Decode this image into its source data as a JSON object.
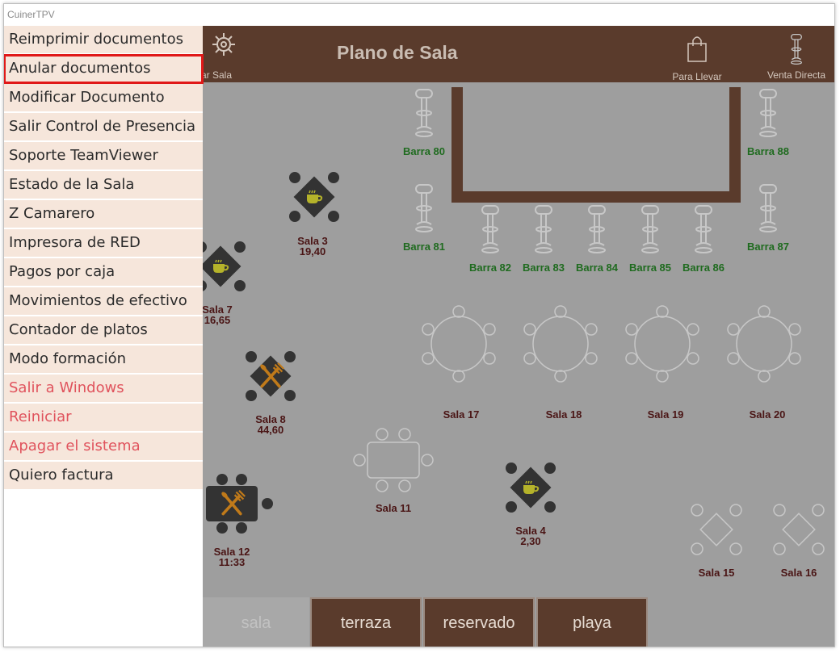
{
  "window": {
    "title": "CuinerTPV"
  },
  "header": {
    "title": "Plano de Sala",
    "config_label": "ar Sala",
    "takeaway_label": "Para Llevar",
    "direct_sale_label": "Venta Directa"
  },
  "menu": {
    "items": [
      {
        "label": "Reimprimir documentos",
        "style": "normal"
      },
      {
        "label": "Anular documentos",
        "style": "selected"
      },
      {
        "label": "Modificar Documento",
        "style": "normal"
      },
      {
        "label": "Salir Control de Presencia",
        "style": "normal"
      },
      {
        "label": "Soporte TeamViewer",
        "style": "normal"
      },
      {
        "label": "Estado de la Sala",
        "style": "normal"
      },
      {
        "label": "Z Camarero",
        "style": "normal"
      },
      {
        "label": "Impresora de RED",
        "style": "normal"
      },
      {
        "label": "Pagos por caja",
        "style": "normal"
      },
      {
        "label": "Movimientos de efectivo",
        "style": "normal"
      },
      {
        "label": "Contador de platos",
        "style": "normal"
      },
      {
        "label": "Modo formación",
        "style": "normal"
      },
      {
        "label": "Salir a Windows",
        "style": "red"
      },
      {
        "label": "Reiniciar",
        "style": "red"
      },
      {
        "label": "Apagar el sistema",
        "style": "red"
      },
      {
        "label": "Quiero factura",
        "style": "normal"
      }
    ]
  },
  "bar_stools": [
    {
      "name": "Barra 80"
    },
    {
      "name": "Barra 81"
    },
    {
      "name": "Barra 82"
    },
    {
      "name": "Barra 83"
    },
    {
      "name": "Barra 84"
    },
    {
      "name": "Barra 85"
    },
    {
      "name": "Barra 86"
    },
    {
      "name": "Barra 87"
    },
    {
      "name": "Barra 88"
    }
  ],
  "tables": {
    "sala3": {
      "name": "Sala 3",
      "value": "19,40",
      "status": "coffee"
    },
    "sala7": {
      "name": "Sala 7",
      "value": "16,65",
      "status": "coffee"
    },
    "sala8": {
      "name": "Sala 8",
      "value": "44,60",
      "status": "dining"
    },
    "sala12": {
      "name": "Sala 12",
      "value": "11:33",
      "status": "dining"
    },
    "sala4": {
      "name": "Sala 4",
      "value": "2,30",
      "status": "coffee"
    },
    "sala11": {
      "name": "Sala 11",
      "status": "free"
    },
    "sala15": {
      "name": "Sala 15",
      "status": "free"
    },
    "sala16": {
      "name": "Sala 16",
      "status": "free"
    },
    "sala17": {
      "name": "Sala 17",
      "status": "free"
    },
    "sala18": {
      "name": "Sala 18",
      "status": "free"
    },
    "sala19": {
      "name": "Sala 19",
      "status": "free"
    },
    "sala20": {
      "name": "Sala 20",
      "status": "free"
    }
  },
  "tabs": [
    {
      "label": "sala",
      "active": true
    },
    {
      "label": "terraza",
      "active": false
    },
    {
      "label": "reservado",
      "active": false
    },
    {
      "label": "playa",
      "active": false
    }
  ],
  "colors": {
    "header_bg": "#5a3b2c",
    "floor_bg": "#9e9e9e",
    "menu_bg": "#f6e6db",
    "stool_label": "#1f6b1f",
    "table_label": "#4a1515",
    "danger_text": "#e0535d",
    "selection_outline": "#e01818",
    "occupied_table": "#333333",
    "coffee_icon": "#b5b32a",
    "dining_icon": "#c07a1a"
  }
}
